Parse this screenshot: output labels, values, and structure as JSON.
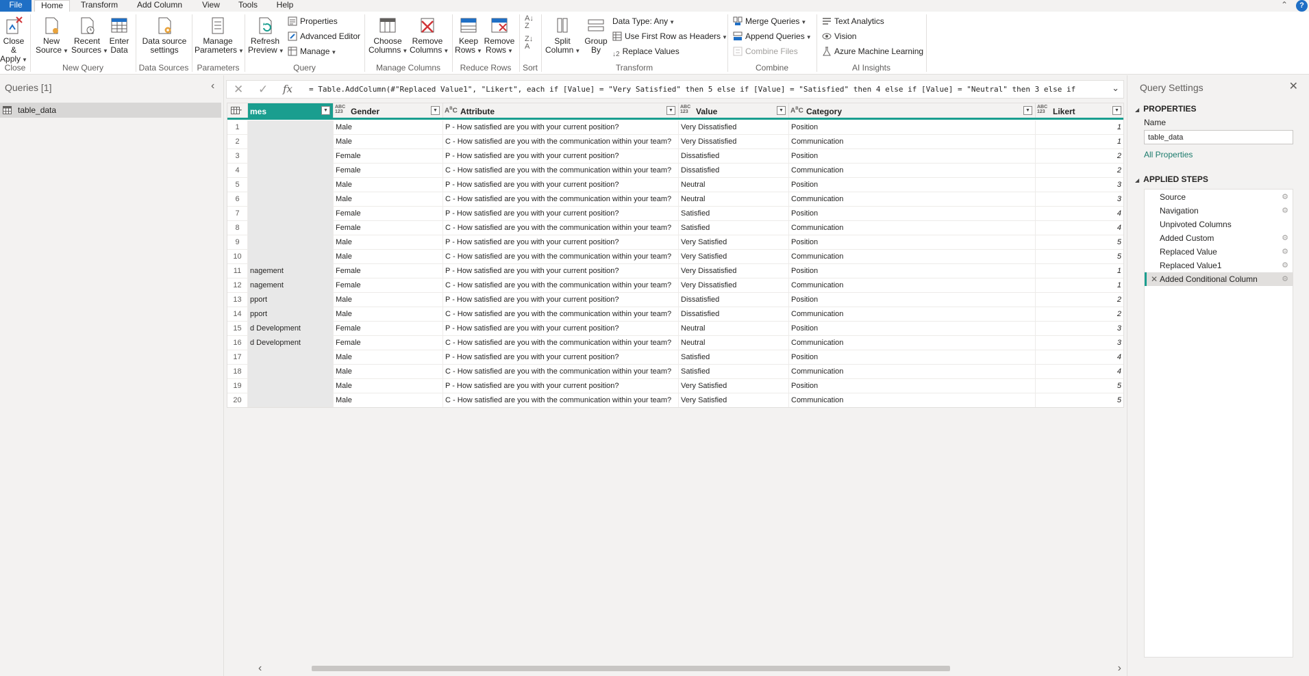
{
  "tabs": {
    "file": "File",
    "home": "Home",
    "transform": "Transform",
    "add_column": "Add Column",
    "view": "View",
    "tools": "Tools",
    "help": "Help"
  },
  "ribbon": {
    "close_apply": [
      "Close &",
      "Apply"
    ],
    "new_source": [
      "New",
      "Source"
    ],
    "recent_sources": [
      "Recent",
      "Sources"
    ],
    "enter_data": [
      "Enter",
      "Data"
    ],
    "data_source_settings": [
      "Data source",
      "settings"
    ],
    "manage_parameters": [
      "Manage",
      "Parameters"
    ],
    "refresh_preview": [
      "Refresh",
      "Preview"
    ],
    "properties": "Properties",
    "advanced_editor": "Advanced Editor",
    "manage": "Manage",
    "choose_columns": [
      "Choose",
      "Columns"
    ],
    "remove_columns": [
      "Remove",
      "Columns"
    ],
    "keep_rows": [
      "Keep",
      "Rows"
    ],
    "remove_rows": [
      "Remove",
      "Rows"
    ],
    "split_column": [
      "Split",
      "Column"
    ],
    "group_by": [
      "Group",
      "By"
    ],
    "data_type": "Data Type: Any",
    "use_first_row": "Use First Row as Headers",
    "replace_values": "Replace Values",
    "merge_queries": "Merge Queries",
    "append_queries": "Append Queries",
    "combine_files": "Combine Files",
    "text_analytics": "Text Analytics",
    "vision": "Vision",
    "azure_ml": "Azure Machine Learning",
    "groups": {
      "close": "Close",
      "new_query": "New Query",
      "data_sources": "Data Sources",
      "parameters": "Parameters",
      "query": "Query",
      "manage_columns": "Manage Columns",
      "reduce_rows": "Reduce Rows",
      "sort": "Sort",
      "transform": "Transform",
      "combine": "Combine",
      "ai_insights": "AI Insights"
    }
  },
  "queries": {
    "title": "Queries [1]",
    "items": [
      {
        "label": "table_data"
      }
    ]
  },
  "formula": {
    "text": "= Table.AddColumn(#\"Replaced Value1\", \"Likert\", each if [Value] = \"Very Satisfied\" then 5 else if [Value] = \"Satisfied\" then 4 else if [Value] = \"Neutral\" then 3 else if"
  },
  "grid": {
    "columns": [
      {
        "name": "mes",
        "type": ""
      },
      {
        "name": "Gender",
        "type": "ABC 123"
      },
      {
        "name": "Attribute",
        "type": "A B C"
      },
      {
        "name": "Value",
        "type": "ABC 123"
      },
      {
        "name": "Category",
        "type": "A B C"
      },
      {
        "name": "Likert",
        "type": "ABC 123"
      }
    ],
    "rows": [
      [
        "1",
        "",
        "Male",
        "P - How satisfied are you with your current position?",
        "Very Dissatisfied",
        "Position",
        "1"
      ],
      [
        "2",
        "",
        "Male",
        "C - How satisfied are you with the communication within your team?",
        "Very Dissatisfied",
        "Communication",
        "1"
      ],
      [
        "3",
        "",
        "Female",
        "P - How satisfied are you with your current position?",
        "Dissatisfied",
        "Position",
        "2"
      ],
      [
        "4",
        "",
        "Female",
        "C - How satisfied are you with the communication within your team?",
        "Dissatisfied",
        "Communication",
        "2"
      ],
      [
        "5",
        "",
        "Male",
        "P - How satisfied are you with your current position?",
        "Neutral",
        "Position",
        "3"
      ],
      [
        "6",
        "",
        "Male",
        "C - How satisfied are you with the communication within your team?",
        "Neutral",
        "Communication",
        "3"
      ],
      [
        "7",
        "",
        "Female",
        "P - How satisfied are you with your current position?",
        "Satisfied",
        "Position",
        "4"
      ],
      [
        "8",
        "",
        "Female",
        "C - How satisfied are you with the communication within your team?",
        "Satisfied",
        "Communication",
        "4"
      ],
      [
        "9",
        "",
        "Male",
        "P - How satisfied are you with your current position?",
        "Very Satisfied",
        "Position",
        "5"
      ],
      [
        "10",
        "",
        "Male",
        "C - How satisfied are you with the communication within your team?",
        "Very Satisfied",
        "Communication",
        "5"
      ],
      [
        "11",
        "nagement",
        "Female",
        "P - How satisfied are you with your current position?",
        "Very Dissatisfied",
        "Position",
        "1"
      ],
      [
        "12",
        "nagement",
        "Female",
        "C - How satisfied are you with the communication within your team?",
        "Very Dissatisfied",
        "Communication",
        "1"
      ],
      [
        "13",
        "pport",
        "Male",
        "P - How satisfied are you with your current position?",
        "Dissatisfied",
        "Position",
        "2"
      ],
      [
        "14",
        "pport",
        "Male",
        "C - How satisfied are you with the communication within your team?",
        "Dissatisfied",
        "Communication",
        "2"
      ],
      [
        "15",
        "d Development",
        "Female",
        "P - How satisfied are you with your current position?",
        "Neutral",
        "Position",
        "3"
      ],
      [
        "16",
        "d Development",
        "Female",
        "C - How satisfied are you with the communication within your team?",
        "Neutral",
        "Communication",
        "3"
      ],
      [
        "17",
        "",
        "Male",
        "P - How satisfied are you with your current position?",
        "Satisfied",
        "Position",
        "4"
      ],
      [
        "18",
        "",
        "Male",
        "C - How satisfied are you with the communication within your team?",
        "Satisfied",
        "Communication",
        "4"
      ],
      [
        "19",
        "",
        "Male",
        "P - How satisfied are you with your current position?",
        "Very Satisfied",
        "Position",
        "5"
      ],
      [
        "20",
        "",
        "Male",
        "C - How satisfied are you with the communication within your team?",
        "Very Satisfied",
        "Communication",
        "5"
      ]
    ]
  },
  "settings": {
    "title": "Query Settings",
    "properties_head": "PROPERTIES",
    "name_label": "Name",
    "name_value": "table_data",
    "all_properties": "All Properties",
    "steps_head": "APPLIED STEPS",
    "steps": [
      {
        "label": "Source",
        "gear": true,
        "selected": false
      },
      {
        "label": "Navigation",
        "gear": true,
        "selected": false
      },
      {
        "label": "Unpivoted Columns",
        "gear": false,
        "selected": false
      },
      {
        "label": "Added Custom",
        "gear": true,
        "selected": false
      },
      {
        "label": "Replaced Value",
        "gear": true,
        "selected": false
      },
      {
        "label": "Replaced Value1",
        "gear": true,
        "selected": false
      },
      {
        "label": "Added Conditional Column",
        "gear": true,
        "selected": true
      }
    ]
  },
  "colors": {
    "accent": "#1a9e8f",
    "file_tab": "#1f6fc5"
  }
}
